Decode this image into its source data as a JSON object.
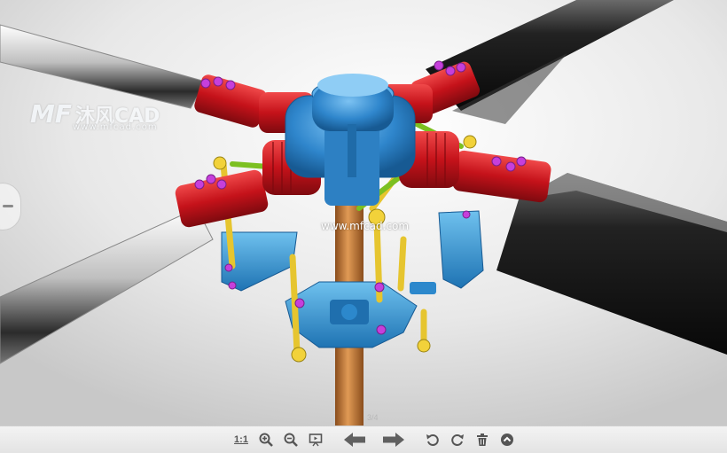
{
  "watermark": {
    "logo_mark": "MF",
    "brand": "沐风CAD",
    "url_left": "www.mfcad.com",
    "url_center": "www.mfcad.com"
  },
  "viewer": {
    "page_indicator": "3/4"
  },
  "toolbar": {
    "actual_size_label": "1:1",
    "buttons": [
      "actual-size",
      "zoom-in",
      "zoom-out",
      "slideshow",
      "previous",
      "next",
      "rotate-left",
      "rotate-right",
      "delete",
      "scroll-up"
    ]
  },
  "colors": {
    "hub": "#3d8fd0",
    "arms": "#d6181c",
    "links": "#f0d43a",
    "bolts": "#c53fd8",
    "shaft": "#c97a35",
    "swash": "#3aa0d9",
    "blade": "#1a1a1a",
    "toolbar_bg": "#ececec",
    "icon": "#555555"
  }
}
